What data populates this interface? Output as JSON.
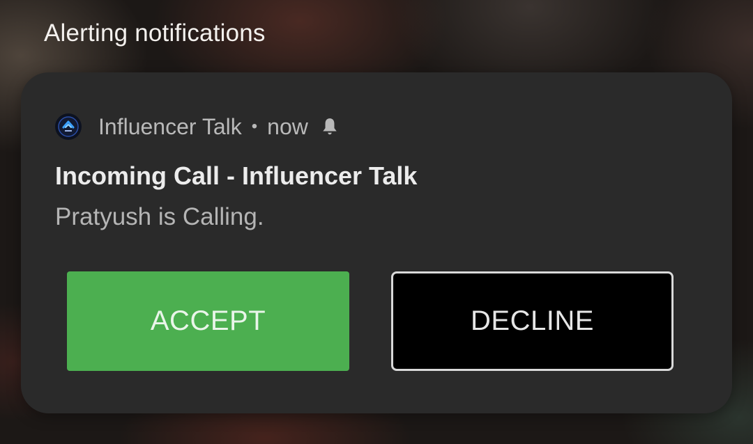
{
  "section": {
    "title": "Alerting notifications"
  },
  "notification": {
    "app_name": "Influencer Talk",
    "separator": "•",
    "time": "now",
    "alert_icon": "bell-icon",
    "app_icon": "influencer-talk-logo-icon",
    "title": "Incoming Call - Influencer Talk",
    "body": "Pratyush is Calling.",
    "actions": {
      "accept_label": "ACCEPT",
      "decline_label": "DECLINE"
    }
  },
  "colors": {
    "accept": "#4caf50",
    "decline": "#000000",
    "card": "#2a2a2a"
  }
}
